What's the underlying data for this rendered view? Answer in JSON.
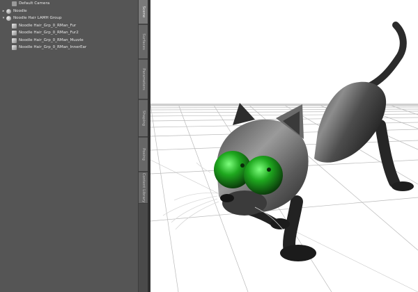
{
  "scene_tree": {
    "items": [
      {
        "label": "Default Camera",
        "icon": "camera-icon",
        "depth": 1,
        "expander": ""
      },
      {
        "label": "Noodle",
        "icon": "figure-icon",
        "depth": 0,
        "expander": "▸"
      },
      {
        "label": "Noodle Hair LAMH Group",
        "icon": "group-icon",
        "depth": 0,
        "expander": "▾"
      },
      {
        "label": "Noodle Hair_Grp_0_RMan_Fur",
        "icon": "hair-node-icon",
        "depth": 1,
        "expander": ""
      },
      {
        "label": "Noodle Hair_Grp_0_RMan_Fur2",
        "icon": "hair-node-icon",
        "depth": 1,
        "expander": ""
      },
      {
        "label": "Noodle Hair_Grp_0_RMan_Muzzle",
        "icon": "hair-node-icon",
        "depth": 1,
        "expander": ""
      },
      {
        "label": "Noodle Hair_Grp_0_RMan_InnerEar",
        "icon": "hair-node-icon",
        "depth": 1,
        "expander": ""
      }
    ]
  },
  "side_tabs": [
    {
      "label": "Scene",
      "active": true
    },
    {
      "label": "Surfaces"
    },
    {
      "label": "Parameters"
    },
    {
      "label": "Shaping"
    },
    {
      "label": "Posing"
    },
    {
      "label": "Content Library"
    }
  ],
  "colors": {
    "panel_bg": "#555555",
    "cat_eye": "#1fa81f",
    "grid": "#b9b9b9"
  }
}
